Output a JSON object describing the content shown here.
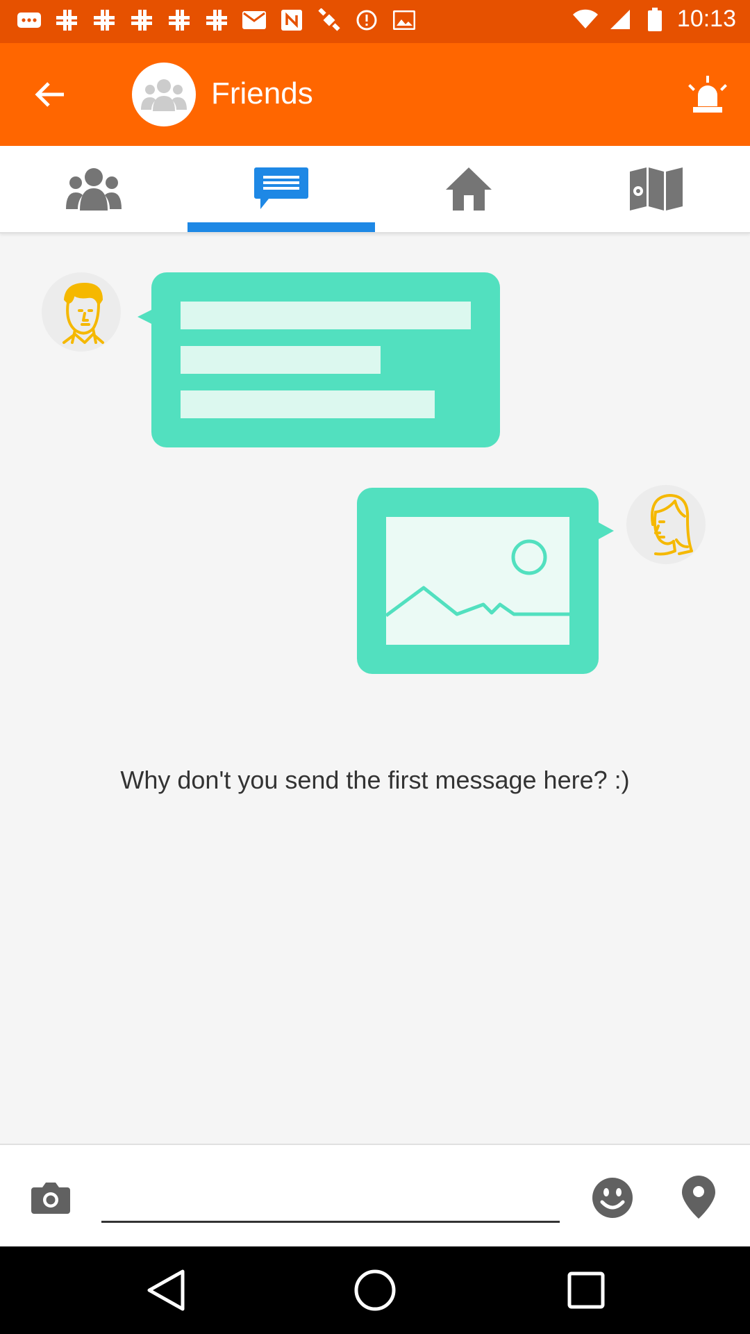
{
  "status_bar": {
    "time": "10:13",
    "left_icons": [
      "more-icon",
      "slack-icon",
      "slack-icon",
      "slack-icon",
      "slack-icon",
      "slack-icon",
      "email-icon",
      "news-icon",
      "satellite-icon",
      "alert-icon",
      "image-icon"
    ],
    "right_icons": [
      "wifi-icon",
      "signal-icon",
      "battery-icon"
    ]
  },
  "app_bar": {
    "title": "Friends",
    "background": "#ff6600"
  },
  "tabs": [
    {
      "name": "friends",
      "icon": "people-icon",
      "active": false
    },
    {
      "name": "messages",
      "icon": "chat-icon",
      "active": true
    },
    {
      "name": "home",
      "icon": "home-icon",
      "active": false
    },
    {
      "name": "map",
      "icon": "map-icon",
      "active": false
    }
  ],
  "colors": {
    "accent": "#1e88e5",
    "bubble": "#52e0bf",
    "bubble_inner": "#dcf8ef",
    "avatar_line": "#f5b800"
  },
  "empty_state": {
    "message": "Why don't you send the first message here? :)"
  },
  "composer": {
    "value": "",
    "placeholder": ""
  }
}
